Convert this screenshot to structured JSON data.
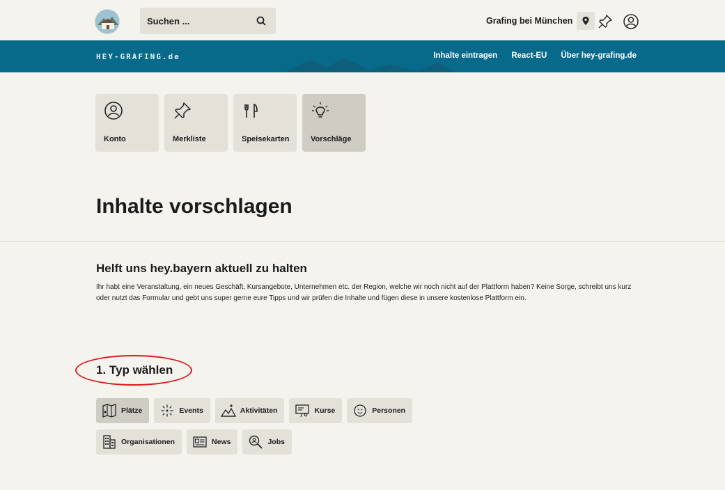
{
  "header": {
    "search_placeholder": "Suchen ...",
    "location": "Grafing bei München"
  },
  "nav": {
    "brand": "HEY-GRAFING.de",
    "links": [
      "Inhalte eintragen",
      "React-EU",
      "Über hey-grafing.de"
    ]
  },
  "tiles": [
    {
      "label": "Konto",
      "icon": "user-circle-icon"
    },
    {
      "label": "Merkliste",
      "icon": "pin-icon"
    },
    {
      "label": "Speisekarten",
      "icon": "cutlery-icon"
    },
    {
      "label": "Vorschläge",
      "icon": "lightbulb-icon",
      "active": true
    }
  ],
  "page": {
    "title": "Inhalte vorschlagen",
    "subtitle": "Helft uns hey.bayern aktuell zu halten",
    "intro": "Ihr habt eine Veranstaltung, ein neues Geschäft, Kursangebote, Unternehmen etc. der Region, welche wir noch nicht auf der Plattform haben? Keine Sorge, schreibt uns kurz oder nutzt das Formular und gebt uns super gerne eure Tipps und wir prüfen die Inhalte und fügen diese in unsere kostenlose Plattform ein.",
    "step_title": "1. Typ wählen"
  },
  "types": [
    {
      "label": "Plätze",
      "icon": "map-icon",
      "active": true
    },
    {
      "label": "Events",
      "icon": "fireworks-icon"
    },
    {
      "label": "Aktivitäten",
      "icon": "hiking-icon"
    },
    {
      "label": "Kurse",
      "icon": "presentation-icon"
    },
    {
      "label": "Personen",
      "icon": "face-icon"
    },
    {
      "label": "Organisationen",
      "icon": "building-icon"
    },
    {
      "label": "News",
      "icon": "newspaper-icon"
    },
    {
      "label": "Jobs",
      "icon": "job-search-icon"
    }
  ],
  "colors": {
    "nav": "#086a8a",
    "highlight": "#d91c1c",
    "tile": "#e3e1d8"
  }
}
